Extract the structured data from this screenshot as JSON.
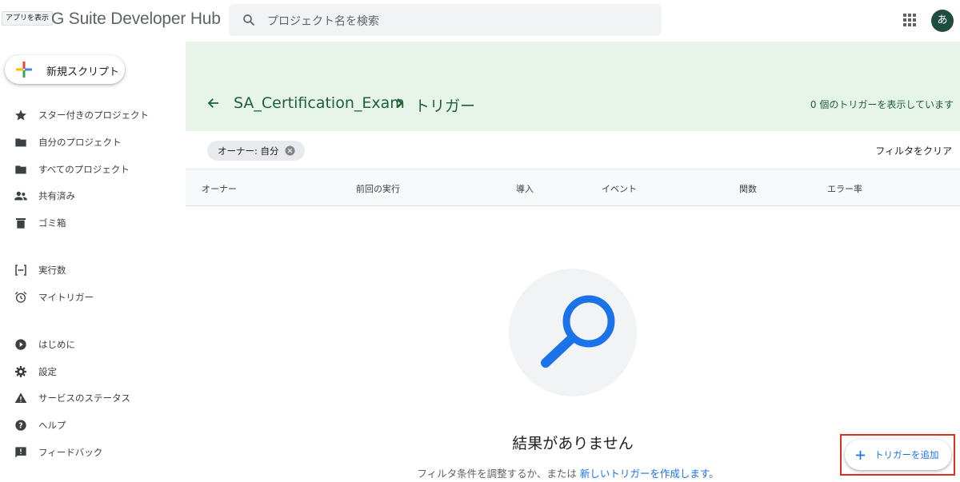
{
  "header": {
    "apps_tooltip": "アプリを表示",
    "logo": "G Suite Developer Hub",
    "search_placeholder": "プロジェクト名を検索",
    "avatar_letter": "あ"
  },
  "sidebar": {
    "new_script": "新規スクリプト",
    "items": [
      {
        "label": "スター付きのプロジェクト",
        "icon": "star-icon"
      },
      {
        "label": "自分のプロジェクト",
        "icon": "folder-icon"
      },
      {
        "label": "すべてのプロジェクト",
        "icon": "folder-icon"
      },
      {
        "label": "共有済み",
        "icon": "people-icon"
      },
      {
        "label": "ゴミ箱",
        "icon": "trash-icon"
      },
      {
        "label": "実行数",
        "icon": "executions-icon"
      },
      {
        "label": "マイトリガー",
        "icon": "alarm-icon"
      },
      {
        "label": "はじめに",
        "icon": "play-icon"
      },
      {
        "label": "設定",
        "icon": "gear-icon"
      },
      {
        "label": "サービスのステータス",
        "icon": "warning-icon"
      },
      {
        "label": "ヘルプ",
        "icon": "help-icon"
      },
      {
        "label": "フィードバック",
        "icon": "feedback-icon"
      }
    ]
  },
  "main": {
    "breadcrumb_project": "SA_Certification_Exam",
    "breadcrumb_current": "トリガー",
    "count_text": "0 個のトリガーを表示しています",
    "filter_chip": "オーナー: 自分",
    "clear_filter": "フィルタをクリア",
    "columns": [
      "オーナー",
      "前回の実行",
      "導入",
      "イベント",
      "関数",
      "エラー率"
    ],
    "empty_title": "結果がありません",
    "empty_desc_prefix": "フィルタ条件を調整するか、または",
    "empty_desc_link": "新しいトリガーを作成します。",
    "add_trigger": "トリガーを追加"
  },
  "colors": {
    "banner": "#e6f4ea",
    "title_green": "#1e5f36",
    "link_blue": "#1a73e8",
    "highlight_red": "#d93025"
  }
}
